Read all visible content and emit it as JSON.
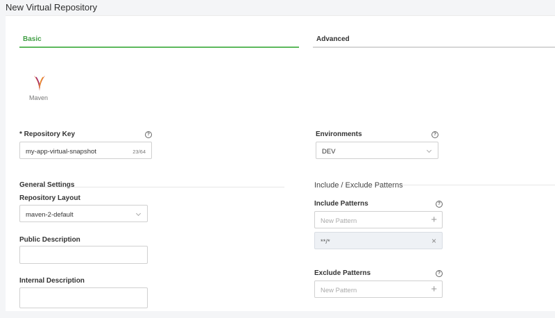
{
  "page": {
    "title": "New Virtual Repository"
  },
  "tabs": [
    {
      "label": "Basic",
      "active": true
    },
    {
      "label": "Advanced",
      "active": false
    }
  ],
  "package": {
    "label": "Maven",
    "icon": "maven-feather-icon"
  },
  "repository_key": {
    "label": "* Repository Key",
    "value": "my-app-virtual-snapshot",
    "counter": "23/64"
  },
  "environments": {
    "label": "Environments",
    "selected": "DEV"
  },
  "general_settings": {
    "title": "General Settings",
    "layout_label": "Repository Layout",
    "layout_selected": "maven-2-default",
    "public_description_label": "Public Description",
    "public_description_value": "",
    "internal_description_label": "Internal Description",
    "internal_description_value": ""
  },
  "patterns": {
    "title": "Include / Exclude Patterns",
    "include_label": "Include Patterns",
    "include_placeholder": "New Pattern",
    "include_items": [
      "**/*"
    ],
    "exclude_label": "Exclude Patterns",
    "exclude_placeholder": "New Pattern"
  },
  "colors": {
    "accent": "#5cb85c",
    "tag_background": "#eef1f5"
  }
}
